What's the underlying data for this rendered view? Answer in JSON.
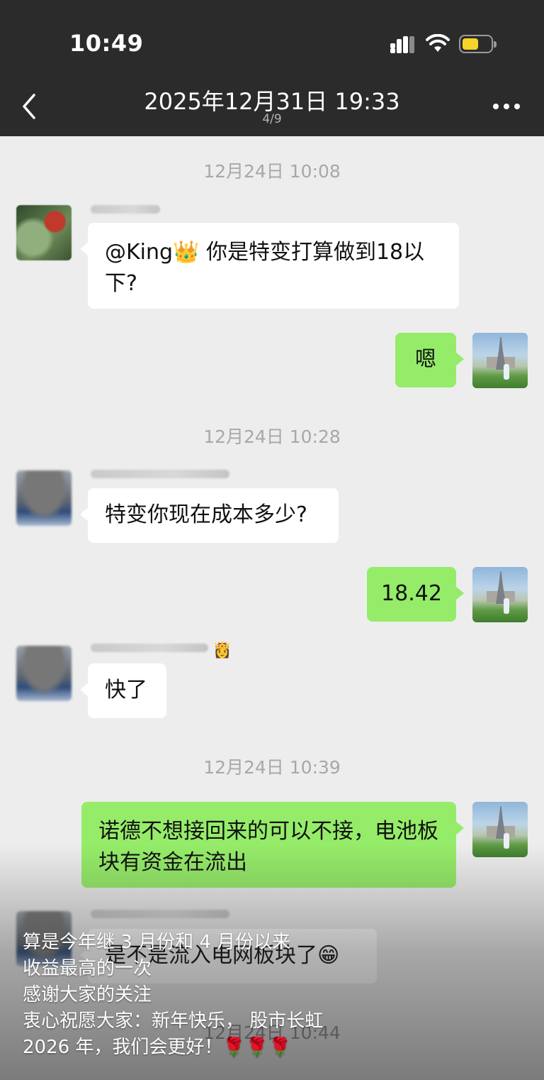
{
  "status_bar": {
    "time": "10:49"
  },
  "nav": {
    "title": "2025年12月31日 19:33",
    "subtitle": "4/9"
  },
  "chat": {
    "timestamps": [
      "12月24日 10:08",
      "12月24日 10:28",
      "12月24日 10:39",
      "12月24日 10:44"
    ],
    "messages": [
      {
        "from": "other",
        "text": "@King👑 你是特变打算做到18以下?"
      },
      {
        "from": "me",
        "text": "嗯"
      },
      {
        "from": "other",
        "text": "特变你现在成本多少?"
      },
      {
        "from": "me",
        "text": "18.42"
      },
      {
        "from": "other",
        "text": "快了",
        "name_emoji": "👸"
      },
      {
        "from": "me",
        "text": "诺德不想接回来的可以不接，电池板块有资金在流出"
      },
      {
        "from": "other",
        "text": "是不是流入电网板块了😁"
      }
    ]
  },
  "caption": {
    "lines": [
      "算是今年继 3 月份和 4 月份以来",
      "收益最高的一次",
      "感谢大家的关注",
      "衷心祝愿大家：新年快乐， 股市长虹",
      "2026 年，我们会更好！🌹🌹🌹"
    ]
  },
  "icons": {
    "status": [
      "signal-icon",
      "wifi-icon",
      "battery-icon"
    ],
    "nav": [
      "back-chevron-icon",
      "more-icon"
    ]
  },
  "colors": {
    "header": "#2b2b2b",
    "chat_bg": "#ededed",
    "my_bubble": "#95ec69",
    "other_bubble": "#ffffff",
    "battery": "#f5d32a"
  }
}
